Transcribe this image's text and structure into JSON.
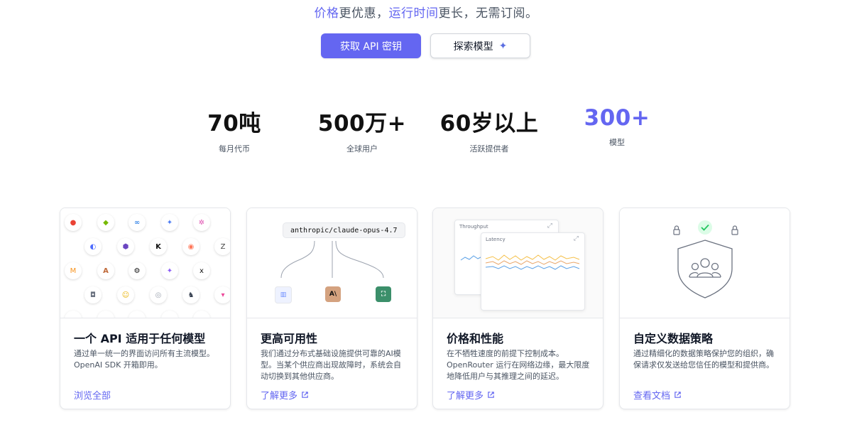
{
  "hero": {
    "tagline_part1": "价格",
    "tagline_part2": "更优惠，",
    "tagline_part3": "运行时间",
    "tagline_part4": "更长，无需订阅。",
    "primary_button": "获取 API 密钥",
    "secondary_button": "探索模型"
  },
  "stats": [
    {
      "value": "70吨",
      "label": "每月代币"
    },
    {
      "value": "500万+",
      "label": "全球用户"
    },
    {
      "value": "60岁以上",
      "label": "活跃提供者"
    },
    {
      "value": "300+",
      "label": "模型"
    }
  ],
  "cards": [
    {
      "title": "一个 API 适用于任何模型",
      "desc": "通过单一统一的界面访问所有主流模型。OpenAI SDK 开箱即用。",
      "link": "浏览全部"
    },
    {
      "title": "更高可用性",
      "desc": "我们通过分布式基础设施提供可靠的AI模型。当某个供应商出现故障时，系统会自动切换到其他供应商。",
      "link": "了解更多",
      "model_pill": "anthropic/claude-opus-4.7",
      "provider_mid": "A\\"
    },
    {
      "title": "价格和性能",
      "desc": "在不牺牲速度的前提下控制成本。OpenRouter 运行在网络边缘，最大限度地降低用户与其推理之间的延迟。",
      "link": "了解更多",
      "panel_back_title": "Throughput",
      "panel_front_title": "Latency"
    },
    {
      "title": "自定义数据策略",
      "desc": "通过精细化的数据策略保护您的组织，确保请求仅发送给您信任的模型和提供商。",
      "link": "查看文档"
    }
  ],
  "colors": {
    "accent": "#6466f1",
    "line_orange": "#f5c04a",
    "line_blue": "#5aa0e6",
    "check_green": "#22c55e"
  }
}
